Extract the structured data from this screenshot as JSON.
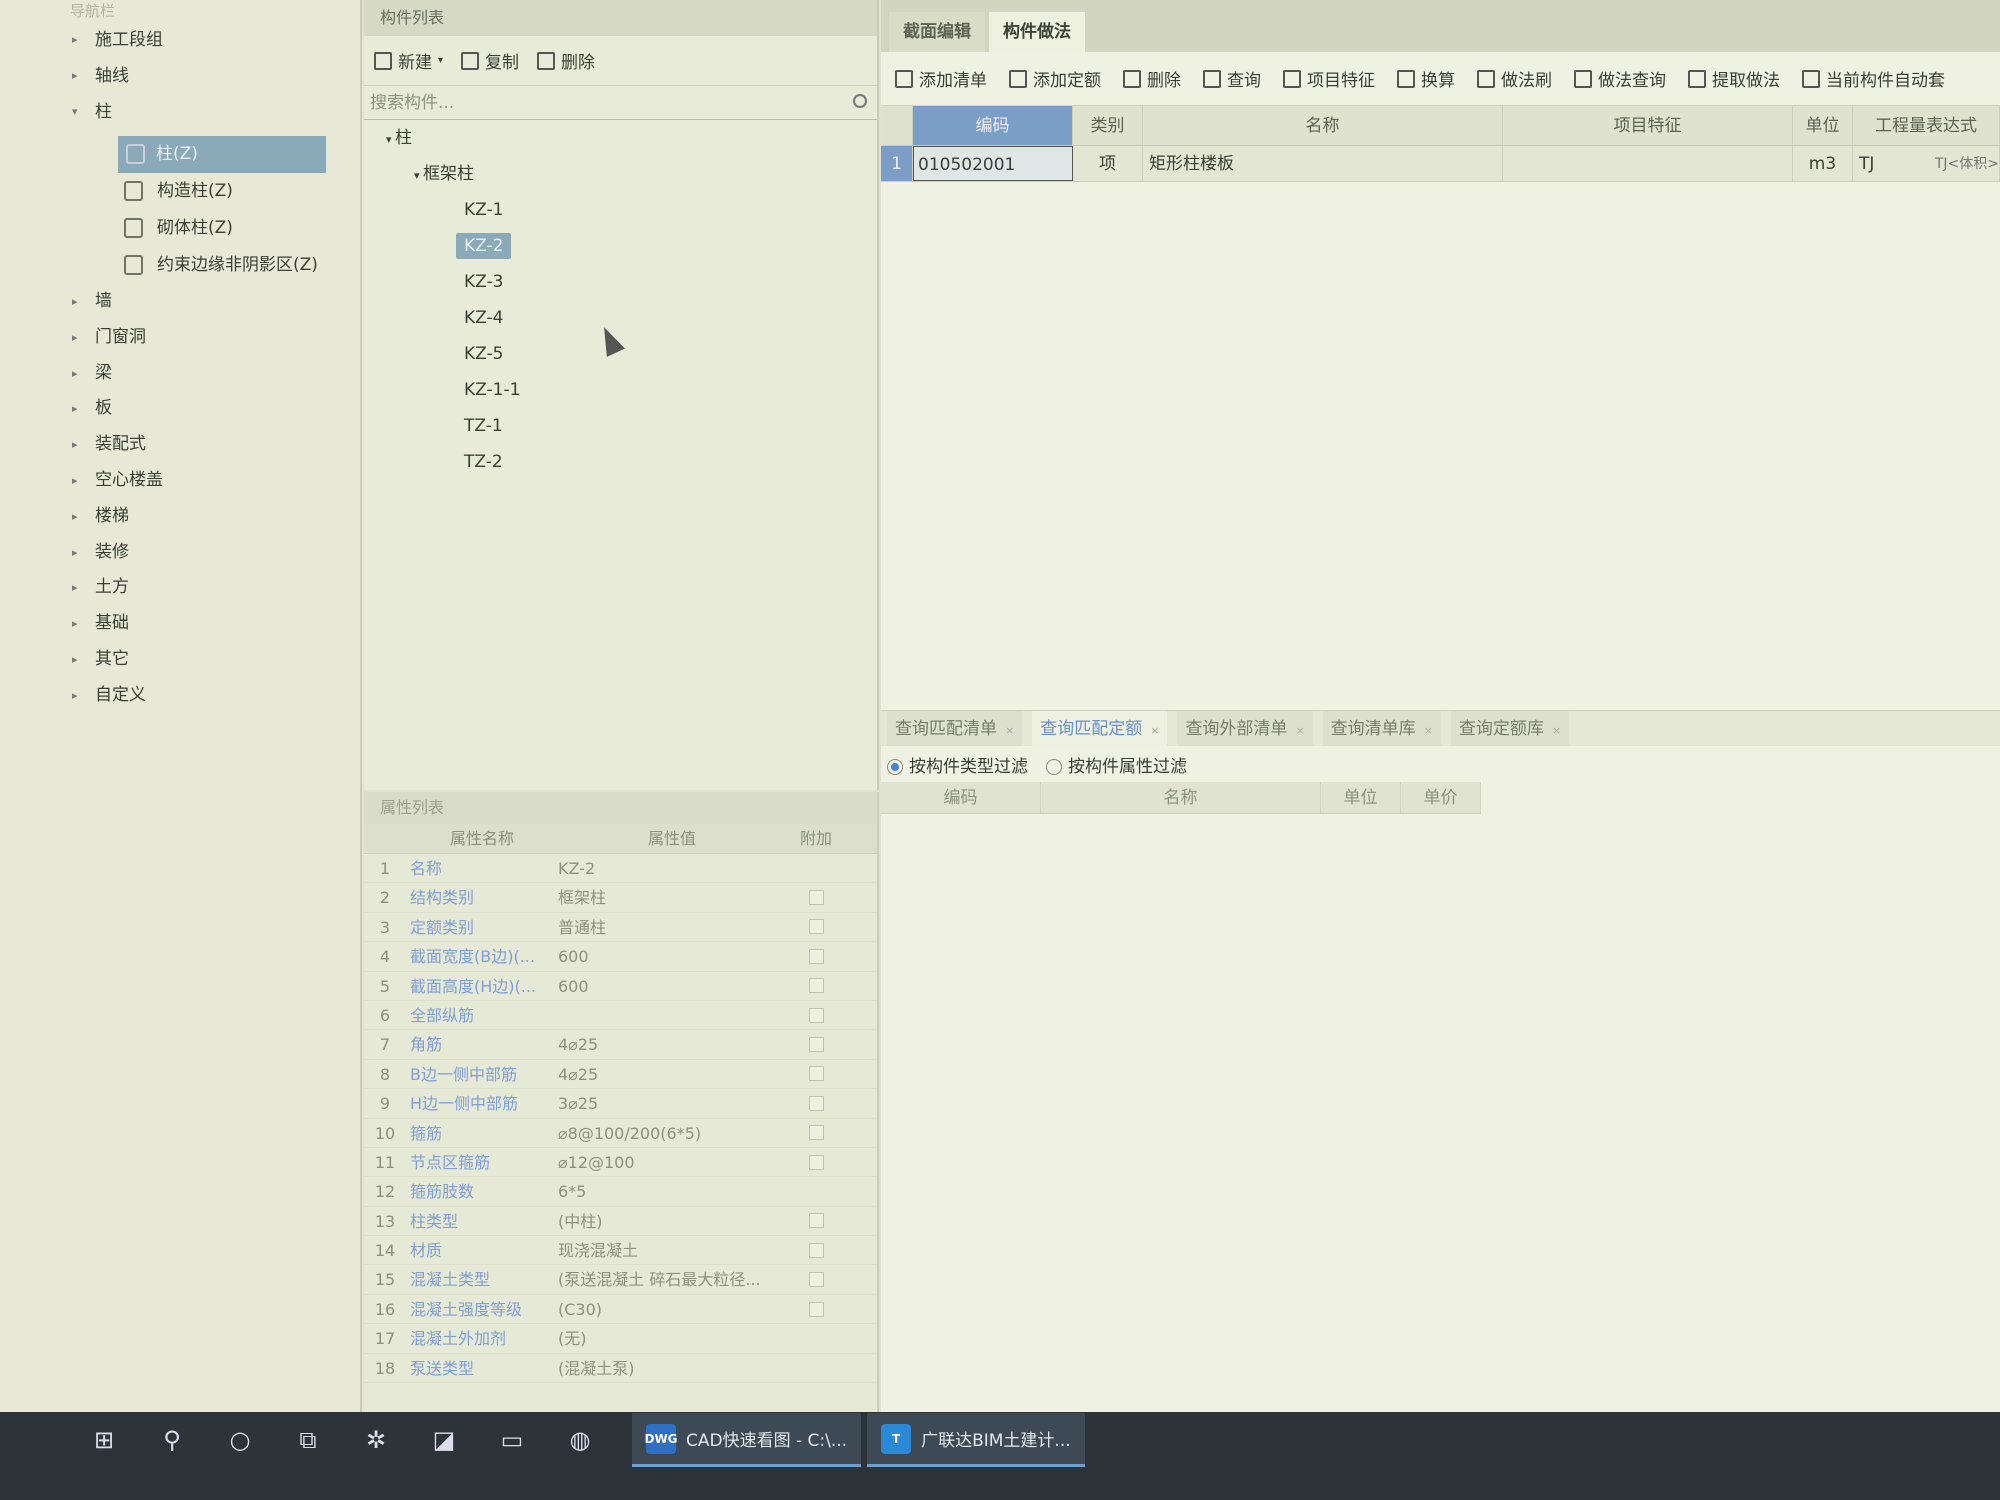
{
  "nav": {
    "title": "导航栏",
    "items_top": [
      {
        "label": "施工段组",
        "arrow": "▸"
      },
      {
        "label": "轴线",
        "arrow": "▸"
      },
      {
        "label": "柱",
        "arrow": "▾"
      }
    ],
    "sub_items": [
      {
        "label": "柱(Z)",
        "selected": true,
        "icon": "column-icon"
      },
      {
        "label": "构造柱(Z)",
        "selected": false,
        "icon": "construction-column-icon"
      },
      {
        "label": "砌体柱(Z)",
        "selected": false,
        "icon": "masonry-column-icon"
      },
      {
        "label": "约束边缘非阴影区(Z)",
        "selected": false,
        "icon": "constraint-edge-icon"
      }
    ],
    "items_bottom": [
      {
        "label": "墙"
      },
      {
        "label": "门窗洞"
      },
      {
        "label": "梁"
      },
      {
        "label": "板"
      },
      {
        "label": "装配式"
      },
      {
        "label": "空心楼盖"
      },
      {
        "label": "楼梯"
      },
      {
        "label": "装修"
      },
      {
        "label": "土方"
      },
      {
        "label": "基础"
      },
      {
        "label": "其它"
      },
      {
        "label": "自定义"
      }
    ]
  },
  "component_list": {
    "title": "构件列表",
    "toolbar": {
      "new": "新建",
      "copy": "复制",
      "delete": "删除"
    },
    "search_placeholder": "搜索构件...",
    "tree_root": "柱",
    "tree_group": "框架柱",
    "leaves": [
      {
        "label": "KZ-1",
        "selected": false
      },
      {
        "label": "KZ-2",
        "selected": true
      },
      {
        "label": "KZ-3",
        "selected": false
      },
      {
        "label": "KZ-4",
        "selected": false
      },
      {
        "label": "KZ-5",
        "selected": false
      },
      {
        "label": "KZ-1-1",
        "selected": false
      },
      {
        "label": "TZ-1",
        "selected": false
      },
      {
        "label": "TZ-2",
        "selected": false
      }
    ]
  },
  "properties": {
    "title": "属性列表",
    "headers": {
      "name": "属性名称",
      "value": "属性值",
      "extra": "附加"
    },
    "rows": [
      {
        "idx": "1",
        "name": "名称",
        "value": "KZ-2",
        "check": false
      },
      {
        "idx": "2",
        "name": "结构类别",
        "value": "框架柱",
        "check": true
      },
      {
        "idx": "3",
        "name": "定额类别",
        "value": "普通柱",
        "check": true
      },
      {
        "idx": "4",
        "name": "截面宽度(B边)(...",
        "value": "600",
        "check": true
      },
      {
        "idx": "5",
        "name": "截面高度(H边)(...",
        "value": "600",
        "check": true
      },
      {
        "idx": "6",
        "name": "全部纵筋",
        "value": "",
        "check": true
      },
      {
        "idx": "7",
        "name": "角筋",
        "value": "4⌀25",
        "check": true
      },
      {
        "idx": "8",
        "name": "B边一侧中部筋",
        "value": "4⌀25",
        "check": true
      },
      {
        "idx": "9",
        "name": "H边一侧中部筋",
        "value": "3⌀25",
        "check": true
      },
      {
        "idx": "10",
        "name": "箍筋",
        "value": "⌀8@100/200(6*5)",
        "check": true
      },
      {
        "idx": "11",
        "name": "节点区箍筋",
        "value": "⌀12@100",
        "check": true
      },
      {
        "idx": "12",
        "name": "箍筋肢数",
        "value": "6*5",
        "check": false
      },
      {
        "idx": "13",
        "name": "柱类型",
        "value": "(中柱)",
        "check": true
      },
      {
        "idx": "14",
        "name": "材质",
        "value": "现浇混凝土",
        "check": true
      },
      {
        "idx": "15",
        "name": "混凝土类型",
        "value": "(泵送混凝土 碎石最大粒径...",
        "check": true
      },
      {
        "idx": "16",
        "name": "混凝土强度等级",
        "value": "(C30)",
        "check": true
      },
      {
        "idx": "17",
        "name": "混凝土外加剂",
        "value": "(无)",
        "check": false
      },
      {
        "idx": "18",
        "name": "泵送类型",
        "value": "(混凝土泵)",
        "check": false
      }
    ]
  },
  "right": {
    "tabs": [
      "截面编辑",
      "构件做法"
    ],
    "toolbar": [
      "添加清单",
      "添加定额",
      "删除",
      "查询",
      "项目特征",
      "换算",
      "做法刷",
      "做法查询",
      "提取做法",
      "当前构件自动套"
    ],
    "grid_headers": [
      "编码",
      "类别",
      "名称",
      "项目特征",
      "单位",
      "工程量表达式"
    ],
    "row": {
      "idx": "1",
      "code": "010502001",
      "type": "项",
      "name": "矩形柱楼板",
      "feature": "",
      "unit": "m3",
      "expr": "TJ",
      "expr2": "TJ<体积>"
    },
    "bottom_tabs": [
      {
        "label": "查询匹配清单",
        "active": false
      },
      {
        "label": "查询匹配定额",
        "active": true
      },
      {
        "label": "查询外部清单",
        "active": false
      },
      {
        "label": "查询清单库",
        "active": false
      },
      {
        "label": "查询定额库",
        "active": false
      }
    ],
    "filters": {
      "by_type": "按构件类型过滤",
      "by_attr": "按构件属性过滤"
    },
    "result_headers": [
      "编码",
      "名称",
      "单位",
      "单价"
    ]
  },
  "taskbar": {
    "apps": [
      {
        "label": "CAD快速看图 - C:\\...",
        "badge": "DWG",
        "color": "#2f6fc6"
      },
      {
        "label": "广联达BIM土建计...",
        "badge": "T",
        "color": "#2a8ad8"
      }
    ]
  }
}
